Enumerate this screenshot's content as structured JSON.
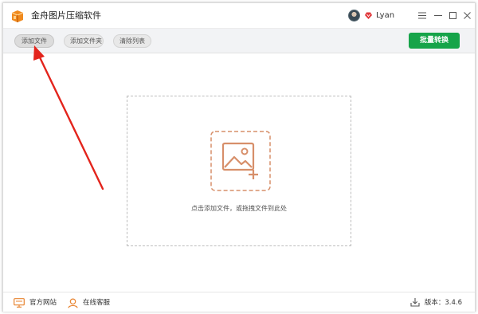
{
  "app": {
    "title": "金舟图片压缩软件",
    "logo_icon": "app-logo-icon",
    "accent_color": "#16a449",
    "drop_icon_color": "#d78f6a"
  },
  "user": {
    "name": "Lyan",
    "avatar_icon": "avatar",
    "vip_icon": "vip-badge-icon"
  },
  "window_controls": {
    "menu_icon": "menu-icon",
    "minimize_icon": "minimize-icon",
    "maximize_icon": "maximize-icon",
    "close_icon": "close-icon"
  },
  "toolbar": {
    "add_file_label": "添加文件",
    "add_folder_label": "添加文件夹",
    "clear_list_label": "清除列表",
    "batch_convert_label": "批量转换"
  },
  "drop_zone": {
    "hint": "点击添加文件，或拖拽文件到此处",
    "icon": "image-add-icon"
  },
  "footer": {
    "website_label": "官方网站",
    "website_icon": "monitor-icon",
    "support_label": "在线客服",
    "support_icon": "user-support-icon",
    "version_label": "版本：3.4.6",
    "version_icon": "download-icon"
  }
}
